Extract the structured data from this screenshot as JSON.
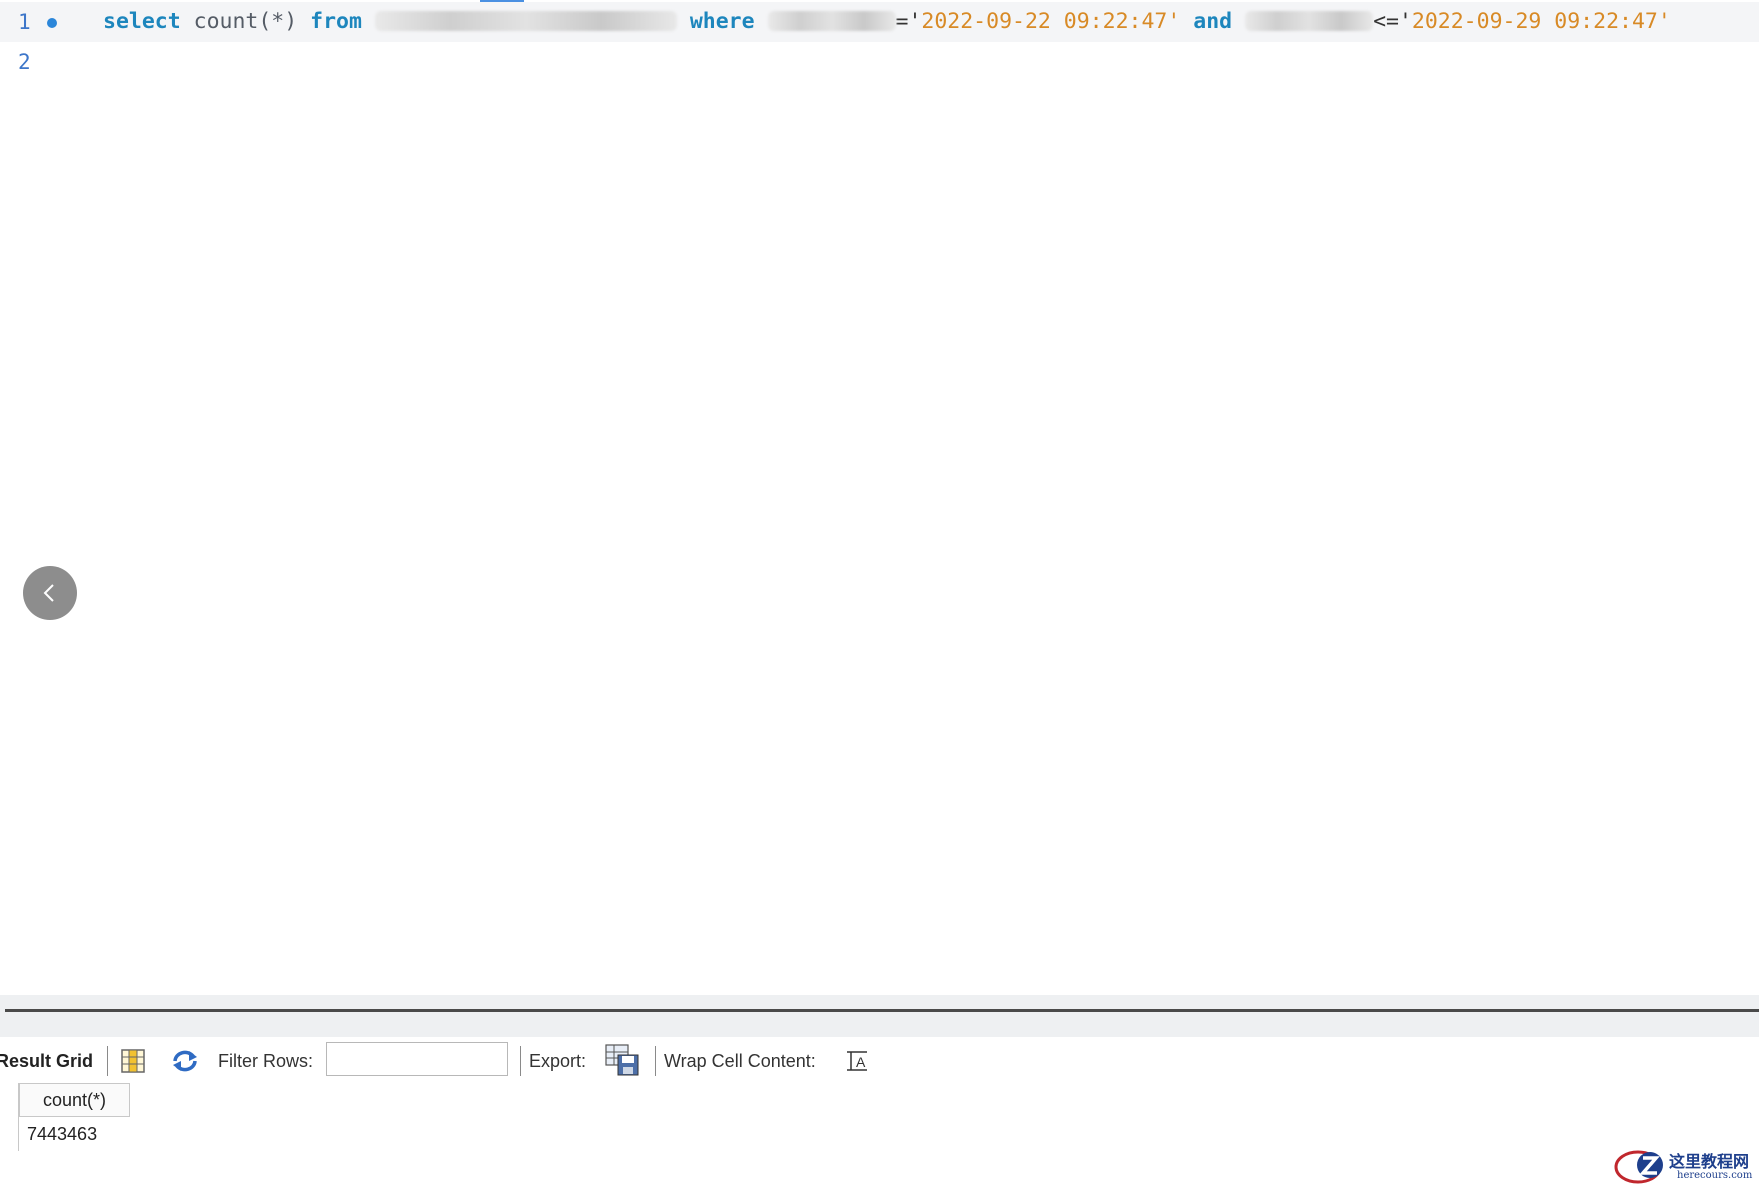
{
  "editor": {
    "lines": [
      {
        "number": "1",
        "tokens": {
          "select": "select",
          "count": "count(*)",
          "from": "from",
          "where": "where",
          "ge": "='",
          "date1": "2022-09-22 09:22:47",
          "q1": "'",
          "and": "and",
          "le": "<='",
          "date2": "2022-09-29 09:22:47",
          "q2": "'"
        }
      },
      {
        "number": "2"
      }
    ]
  },
  "toolbar": {
    "result_grid_label": "Result Grid",
    "filter_rows_label": "Filter Rows:",
    "filter_value": "",
    "export_label": "Export:",
    "wrap_label": "Wrap Cell Content:"
  },
  "grid": {
    "columns": [
      "count(*)"
    ],
    "rows": [
      [
        "7443463"
      ]
    ]
  },
  "watermark": {
    "title": "这里教程网",
    "subtitle": "herecours.com"
  },
  "colors": {
    "keyword": "#1d86bd",
    "string": "#d88a26",
    "line_number": "#3d76c9",
    "bullet": "#2b86d9"
  },
  "icons": [
    "bullet-icon",
    "chevron-left-icon",
    "column-toggle-icon",
    "refresh-icon",
    "export-save-icon",
    "wrap-text-icon"
  ]
}
